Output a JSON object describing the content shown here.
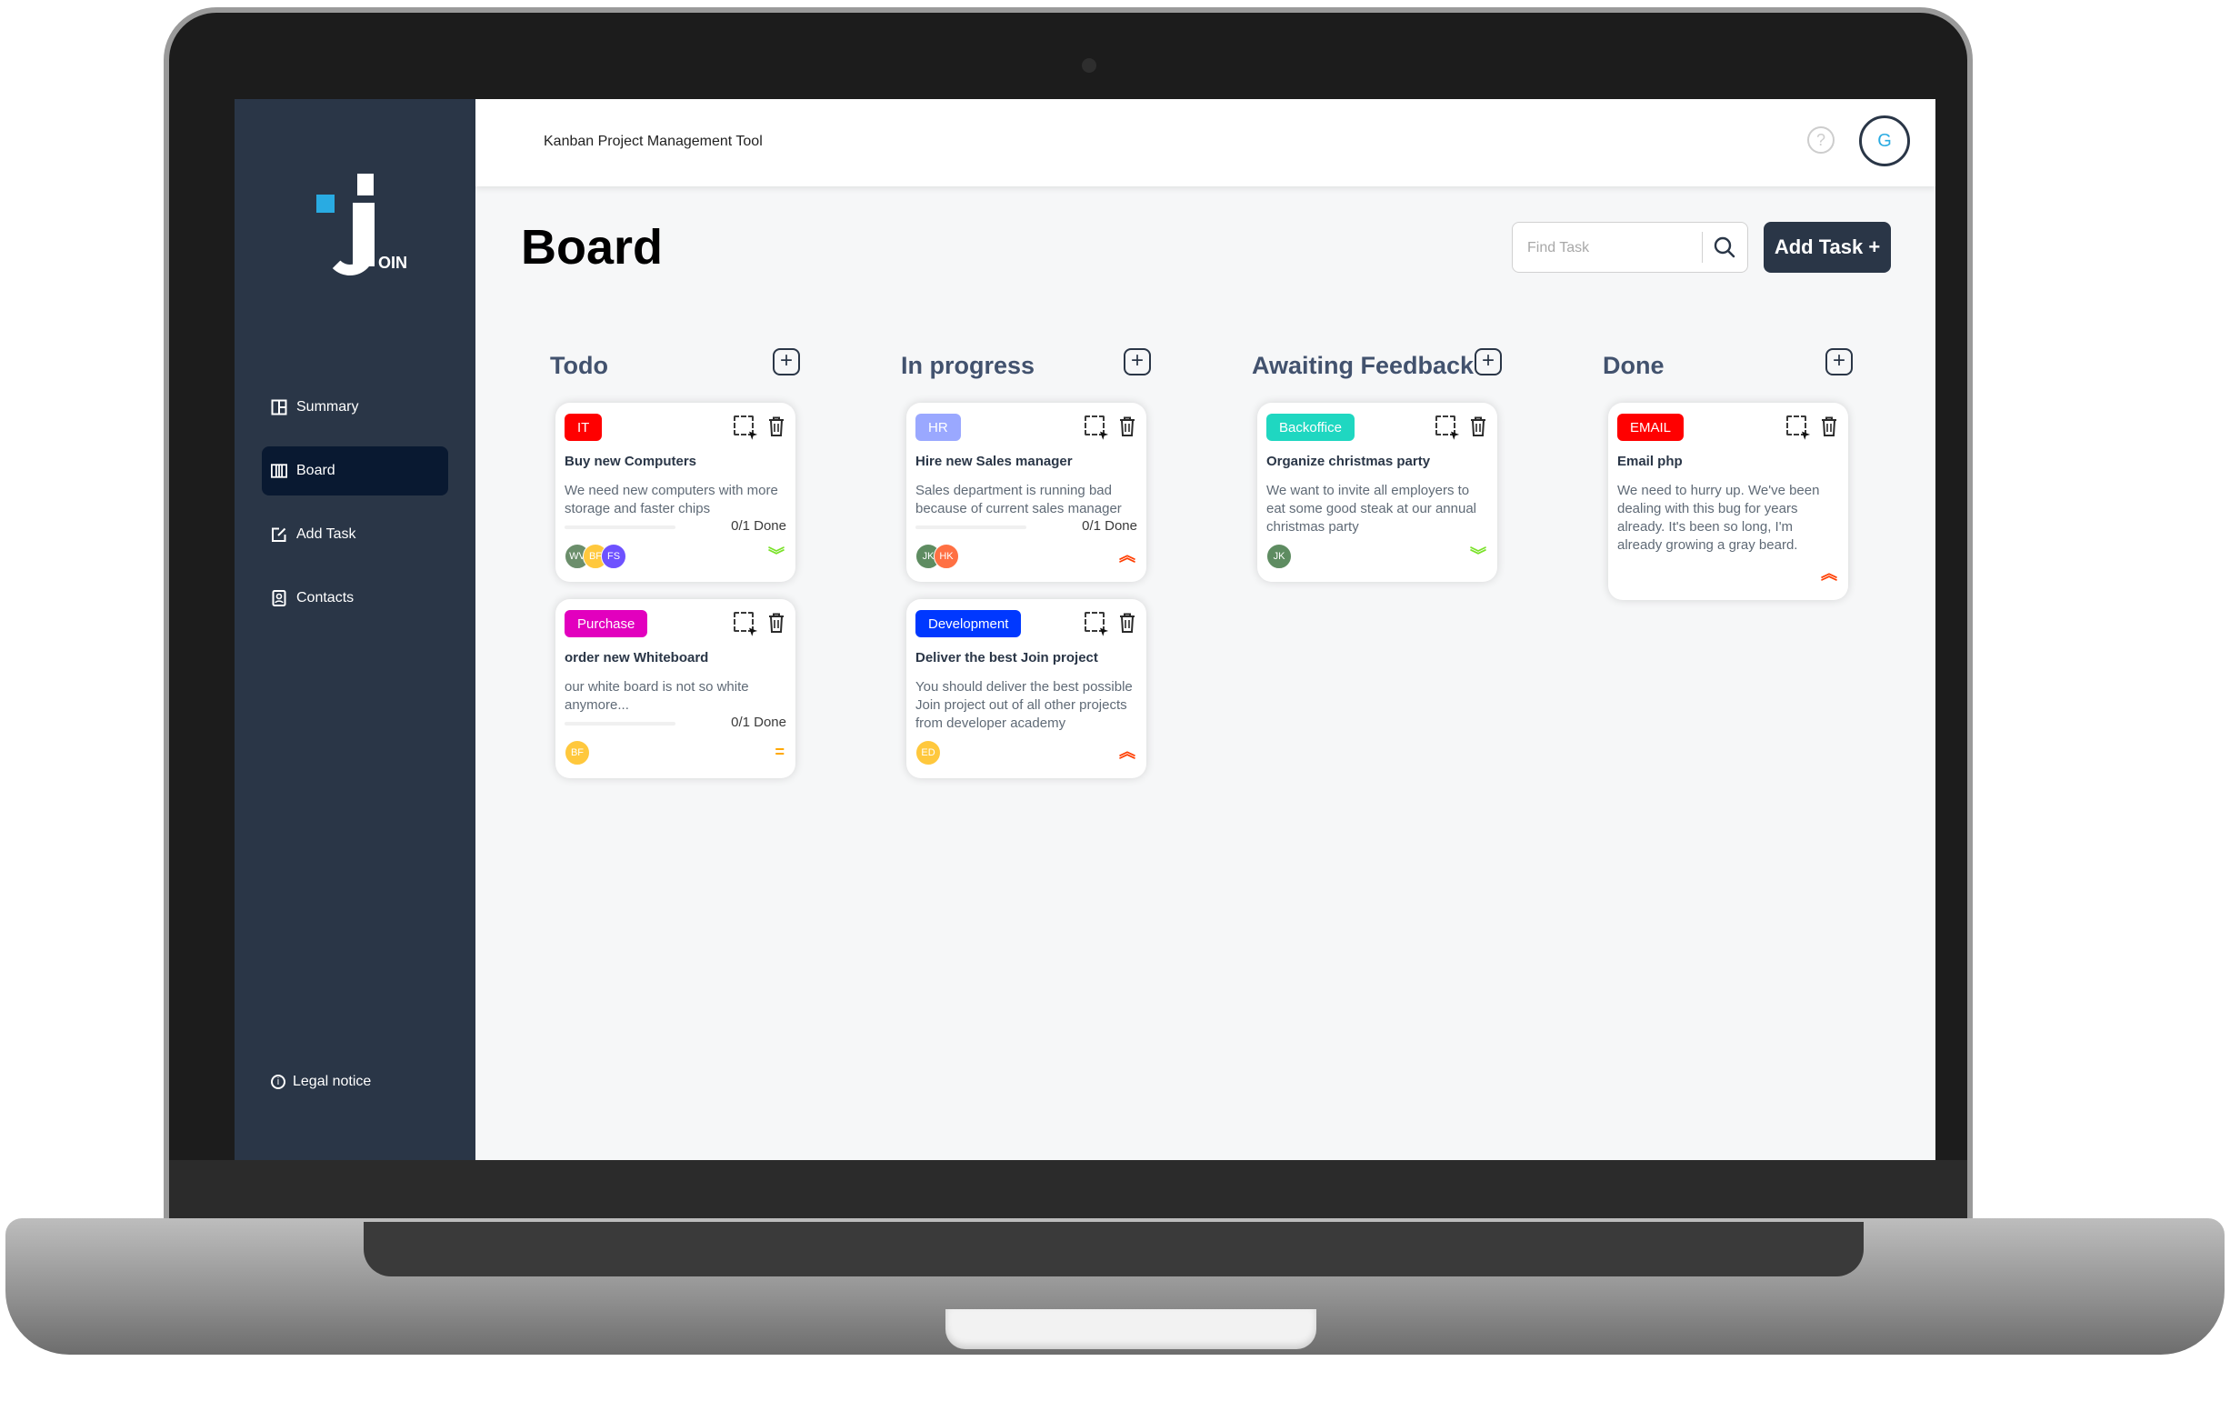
{
  "app": {
    "title": "Kanban Project Management Tool",
    "logo_text": "OIN",
    "user_initial": "G",
    "help_symbol": "?"
  },
  "colors": {
    "sidebar": "#2a3647",
    "active_nav": "#091931",
    "accent": "#29abe2",
    "priority_urgent": "#ff3d00",
    "priority_medium": "#ffa800",
    "priority_low": "#7ae229"
  },
  "sidebar": {
    "items": [
      {
        "label": "Summary",
        "icon": "summary-icon",
        "active": false
      },
      {
        "label": "Board",
        "icon": "board-icon",
        "active": true
      },
      {
        "label": "Add Task",
        "icon": "add-task-icon",
        "active": false
      },
      {
        "label": "Contacts",
        "icon": "contacts-icon",
        "active": false
      }
    ],
    "legal_notice": "Legal notice"
  },
  "board": {
    "title": "Board",
    "search_placeholder": "Find Task",
    "add_task_label": "Add Task +",
    "columns": [
      {
        "title": "Todo",
        "add_symbol": "+"
      },
      {
        "title": "In progress",
        "add_symbol": "+"
      },
      {
        "title": "Awaiting Feedback",
        "add_symbol": "+"
      },
      {
        "title": "Done",
        "add_symbol": "+"
      }
    ]
  },
  "cards": [
    {
      "column": "Todo",
      "tag": "IT",
      "tag_color": "#ff0000",
      "title": "Buy new Computers",
      "description": "We need new computers with more storage and faster chips",
      "subtasks_done": "0/1 Done",
      "progress": 0,
      "avatars": [
        {
          "initials": "WV",
          "color": "#6b8e6b"
        },
        {
          "initials": "BF",
          "color": "#ffc83d"
        },
        {
          "initials": "FS",
          "color": "#6e52ff"
        }
      ],
      "priority": "low",
      "priority_symbol": "︾"
    },
    {
      "column": "Todo",
      "tag": "Purchase",
      "tag_color": "#e200be",
      "title": "order new Whiteboard",
      "description": "our white board is not so white anymore...",
      "subtasks_done": "0/1 Done",
      "progress": 0,
      "avatars": [
        {
          "initials": "BF",
          "color": "#ffc83d"
        }
      ],
      "priority": "medium",
      "priority_symbol": "="
    },
    {
      "column": "In progress",
      "tag": "HR",
      "tag_color": "#9aa8ff",
      "title": "Hire new Sales manager",
      "description": "Sales department is running bad because of current sales manager",
      "subtasks_done": "0/1 Done",
      "progress": 0,
      "avatars": [
        {
          "initials": "JK",
          "color": "#5e8c61"
        },
        {
          "initials": "HK",
          "color": "#ff7043"
        }
      ],
      "priority": "urgent",
      "priority_symbol": "︽"
    },
    {
      "column": "In progress",
      "tag": "Development",
      "tag_color": "#0038ff",
      "title": "Deliver the best Join project",
      "description": "You should deliver the best possible Join project out of all other projects from developer academy",
      "subtasks_done": "",
      "progress": null,
      "avatars": [
        {
          "initials": "ED",
          "color": "#ffc83d"
        }
      ],
      "priority": "urgent",
      "priority_symbol": "︽"
    },
    {
      "column": "Awaiting Feedback",
      "tag": "Backoffice",
      "tag_color": "#1fd7c1",
      "title": "Organize christmas party",
      "description": "We want to invite all employers to eat some good steak at our annual christmas party",
      "subtasks_done": "",
      "progress": null,
      "avatars": [
        {
          "initials": "JK",
          "color": "#5e8c61"
        }
      ],
      "priority": "low",
      "priority_symbol": "︾"
    },
    {
      "column": "Done",
      "tag": "EMAIL",
      "tag_color": "#ff0000",
      "title": "Email php",
      "description": "We need to hurry up. We've been dealing with this bug for years already. It's been so long, I'm already growing a gray beard.",
      "subtasks_done": "",
      "progress": null,
      "avatars": [],
      "priority": "urgent",
      "priority_symbol": "︽"
    }
  ]
}
